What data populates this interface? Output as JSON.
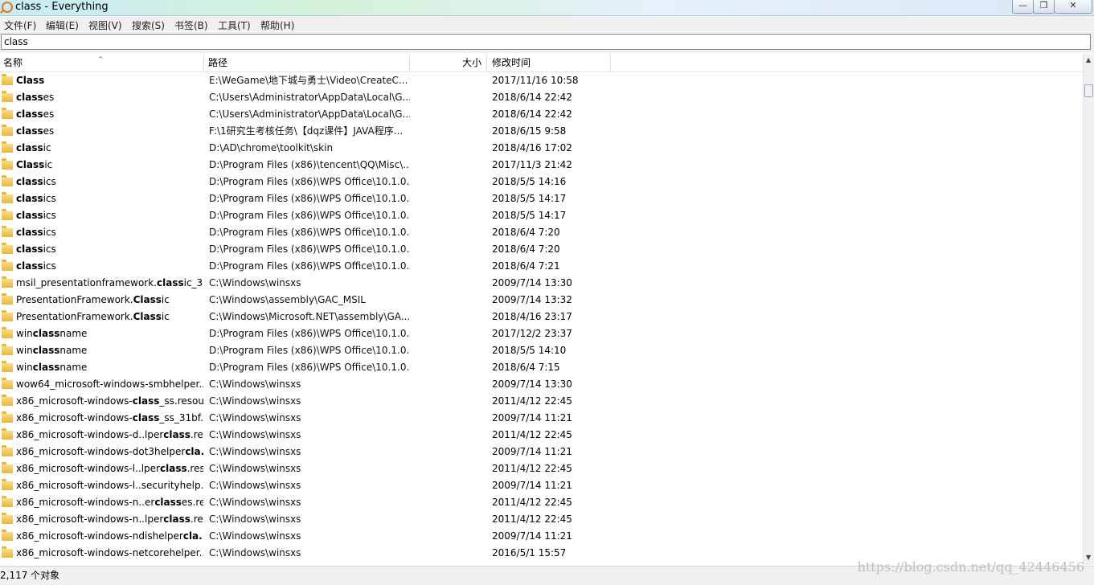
{
  "window": {
    "title": "class - Everything",
    "minimize_glyph": "—",
    "restore_glyph": "❐",
    "close_glyph": "✕"
  },
  "menu": [
    "文件(F)",
    "编辑(E)",
    "视图(V)",
    "搜索(S)",
    "书签(B)",
    "工具(T)",
    "帮助(H)"
  ],
  "search": {
    "value": "class"
  },
  "columns": {
    "name": "名称",
    "path": "路径",
    "size": "大小",
    "date": "修改时间"
  },
  "sort_indicator": "^",
  "rows": [
    {
      "pre": "",
      "match": "Class",
      "post": "",
      "path": "E:\\WeGame\\地下城与勇士\\Video\\CreateC...",
      "date": "2017/11/16 10:58"
    },
    {
      "pre": "",
      "match": "class",
      "post": "es",
      "path": "C:\\Users\\Administrator\\AppData\\Local\\G...",
      "date": "2018/6/14 22:42"
    },
    {
      "pre": "",
      "match": "class",
      "post": "es",
      "path": "C:\\Users\\Administrator\\AppData\\Local\\G...",
      "date": "2018/6/14 22:42"
    },
    {
      "pre": "",
      "match": "class",
      "post": "es",
      "path": "F:\\1研究生考核任务\\【dqz课件】JAVA程序...",
      "date": "2018/6/15 9:58"
    },
    {
      "pre": "",
      "match": "class",
      "post": "ic",
      "path": "D:\\AD\\chrome\\toolkit\\skin",
      "date": "2018/4/16 17:02"
    },
    {
      "pre": "",
      "match": "Class",
      "post": "ic",
      "path": "D:\\Program Files (x86)\\tencent\\QQ\\Misc\\...",
      "date": "2017/11/3 21:42"
    },
    {
      "pre": "",
      "match": "class",
      "post": "ics",
      "path": "D:\\Program Files (x86)\\WPS Office\\10.1.0...",
      "date": "2018/5/5 14:16"
    },
    {
      "pre": "",
      "match": "class",
      "post": "ics",
      "path": "D:\\Program Files (x86)\\WPS Office\\10.1.0...",
      "date": "2018/5/5 14:17"
    },
    {
      "pre": "",
      "match": "class",
      "post": "ics",
      "path": "D:\\Program Files (x86)\\WPS Office\\10.1.0...",
      "date": "2018/5/5 14:17"
    },
    {
      "pre": "",
      "match": "class",
      "post": "ics",
      "path": "D:\\Program Files (x86)\\WPS Office\\10.1.0...",
      "date": "2018/6/4 7:20"
    },
    {
      "pre": "",
      "match": "class",
      "post": "ics",
      "path": "D:\\Program Files (x86)\\WPS Office\\10.1.0...",
      "date": "2018/6/4 7:20"
    },
    {
      "pre": "",
      "match": "class",
      "post": "ics",
      "path": "D:\\Program Files (x86)\\WPS Office\\10.1.0...",
      "date": "2018/6/4 7:21"
    },
    {
      "pre": "msil_presentationframework.",
      "match": "class",
      "post": "ic_3...",
      "path": "C:\\Windows\\winsxs",
      "date": "2009/7/14 13:30"
    },
    {
      "pre": "PresentationFramework.",
      "match": "Class",
      "post": "ic",
      "path": "C:\\Windows\\assembly\\GAC_MSIL",
      "date": "2009/7/14 13:32"
    },
    {
      "pre": "PresentationFramework.",
      "match": "Class",
      "post": "ic",
      "path": "C:\\Windows\\Microsoft.NET\\assembly\\GA...",
      "date": "2018/4/16 23:17"
    },
    {
      "pre": "win",
      "match": "class",
      "post": "name",
      "path": "D:\\Program Files (x86)\\WPS Office\\10.1.0...",
      "date": "2017/12/2 23:37"
    },
    {
      "pre": "win",
      "match": "class",
      "post": "name",
      "path": "D:\\Program Files (x86)\\WPS Office\\10.1.0...",
      "date": "2018/5/5 14:10"
    },
    {
      "pre": "win",
      "match": "class",
      "post": "name",
      "path": "D:\\Program Files (x86)\\WPS Office\\10.1.0...",
      "date": "2018/6/4 7:15"
    },
    {
      "pre": "wow64_microsoft-windows-smbhelper...",
      "match": "",
      "post": "",
      "path": "C:\\Windows\\winsxs",
      "date": "2009/7/14 13:30"
    },
    {
      "pre": "x86_microsoft-windows-",
      "match": "class",
      "post": "_ss.resou...",
      "path": "C:\\Windows\\winsxs",
      "date": "2011/4/12 22:45"
    },
    {
      "pre": "x86_microsoft-windows-",
      "match": "class",
      "post": "_ss_31bf...",
      "path": "C:\\Windows\\winsxs",
      "date": "2009/7/14 11:21"
    },
    {
      "pre": "x86_microsoft-windows-d..lper",
      "match": "class",
      "post": ".re...",
      "path": "C:\\Windows\\winsxs",
      "date": "2011/4/12 22:45"
    },
    {
      "pre": "x86_microsoft-windows-dot3helper",
      "match": "cla...",
      "post": "",
      "path": "C:\\Windows\\winsxs",
      "date": "2009/7/14 11:21"
    },
    {
      "pre": "x86_microsoft-windows-l..lper",
      "match": "class",
      "post": ".res...",
      "path": "C:\\Windows\\winsxs",
      "date": "2011/4/12 22:45"
    },
    {
      "pre": "x86_microsoft-windows-l..securityhelp...",
      "match": "",
      "post": "",
      "path": "C:\\Windows\\winsxs",
      "date": "2009/7/14 11:21"
    },
    {
      "pre": "x86_microsoft-windows-n..er",
      "match": "class",
      "post": "es.re...",
      "path": "C:\\Windows\\winsxs",
      "date": "2011/4/12 22:45"
    },
    {
      "pre": "x86_microsoft-windows-n..lper",
      "match": "class",
      "post": ".re...",
      "path": "C:\\Windows\\winsxs",
      "date": "2011/4/12 22:45"
    },
    {
      "pre": "x86_microsoft-windows-ndishelper",
      "match": "cla...",
      "post": "",
      "path": "C:\\Windows\\winsxs",
      "date": "2009/7/14 11:21"
    },
    {
      "pre": "x86_microsoft-windows-netcorehelper...",
      "match": "",
      "post": "",
      "path": "C:\\Windows\\winsxs",
      "date": "2016/5/1 15:57"
    }
  ],
  "status": {
    "count": "2,117 个对象"
  },
  "watermark": "https://blog.csdn.net/qq_42446456",
  "colors": {
    "folder": "#e8b73c",
    "title_gradient_start": "#c9ecf7"
  }
}
